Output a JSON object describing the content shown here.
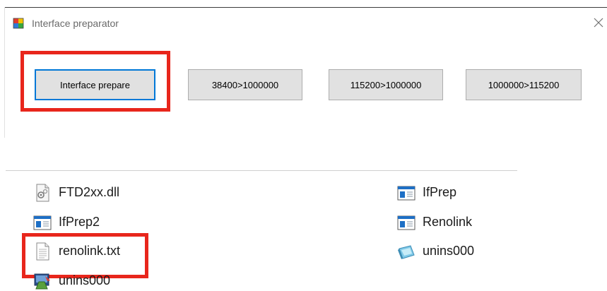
{
  "window": {
    "title": "Interface preparator"
  },
  "buttons": [
    {
      "label": "Interface prepare"
    },
    {
      "label": "38400>1000000"
    },
    {
      "label": "115200>1000000"
    },
    {
      "label": "1000000>115200"
    }
  ],
  "files": [
    {
      "name": "FTD2xx.dll",
      "icon": "dll-file-icon"
    },
    {
      "name": "IfPrep",
      "icon": "application-icon"
    },
    {
      "name": "IfPrep2",
      "icon": "application-icon"
    },
    {
      "name": "Renolink",
      "icon": "application-icon"
    },
    {
      "name": "renolink.txt",
      "icon": "text-file-icon"
    },
    {
      "name": "unins000",
      "icon": "uninstall-data-icon"
    },
    {
      "name": "unins000",
      "icon": "uninstaller-icon"
    }
  ],
  "colors": {
    "highlight": "#e8261c",
    "focus_border": "#0078d7",
    "button_face": "#e1e1e1"
  }
}
